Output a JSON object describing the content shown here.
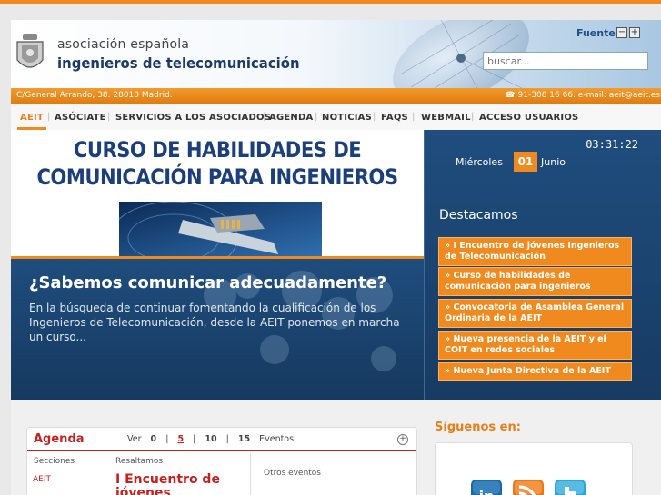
{
  "header": {
    "logo_line1": "asociación española",
    "logo_line2": "ingenieros de telecomunicación",
    "font_label": "Fuente",
    "font_decrease": "−",
    "font_increase": "+",
    "search_placeholder": "buscar...",
    "address": "C/General Arrando, 38. 28010 Madrid.",
    "contact": "☎ 91-308 16 66. e-mail: aeit@aeit.es"
  },
  "nav": {
    "items": [
      "AEIT",
      "ASÓCIATE",
      "SERVICIOS A LOS ASOCIADOS",
      "AGENDA",
      "NOTICIAS",
      "FAQS",
      "WEBMAIL",
      "ACCESO USUARIOS"
    ],
    "active": "AEIT"
  },
  "feature": {
    "title_line1": "CURSO DE HABILIDADES DE",
    "title_line2": "COMUNICACIÓN PARA INGENIEROS",
    "heading": "¿Sabemos comunicar adecuadamente?",
    "body": "En la búsqueda de continuar fomentando la cualificación de los Ingenieros de Telecomunicación, desde la AEIT ponemos en marcha un curso..."
  },
  "side": {
    "clock": "03:31:22",
    "day_name": "Miércoles",
    "day_number": "01",
    "month": "Junio",
    "destacamos_title": "Destacamos",
    "items": [
      "» I Encuentro de jóvenes Ingenieros de Telecomunicación",
      "» Curso de habilidades de comunicación para ingenieros",
      "» Convocatoria de Asamblea General Ordinaria de la AEIT",
      "» Nueva presencia de la AEIT y el COIT en redes sociales",
      "» Nueva Junta Directiva de la AEIT"
    ]
  },
  "agenda": {
    "title": "Agenda",
    "ver_label": "Ver",
    "options": [
      "0",
      "|",
      "5",
      "|",
      "10",
      "|",
      "15"
    ],
    "selected": "5",
    "eventos_label": "Eventos",
    "plus": "+",
    "col_secciones": "Secciones",
    "col_resaltamos": "Resaltamos",
    "section_value": "AEIT",
    "event_title": "I Encuentro de jóvenes",
    "otros": "Otros eventos"
  },
  "social": {
    "title": "Síguenos en:",
    "icons": [
      "linkedin-icon",
      "rss-icon",
      "twitter-icon"
    ],
    "linkedin_text": "in"
  },
  "colors": {
    "accent": "#f08a1f",
    "navy": "#1b3f7a",
    "panel": "#1f4d7e",
    "agenda_red": "#c8201e"
  }
}
